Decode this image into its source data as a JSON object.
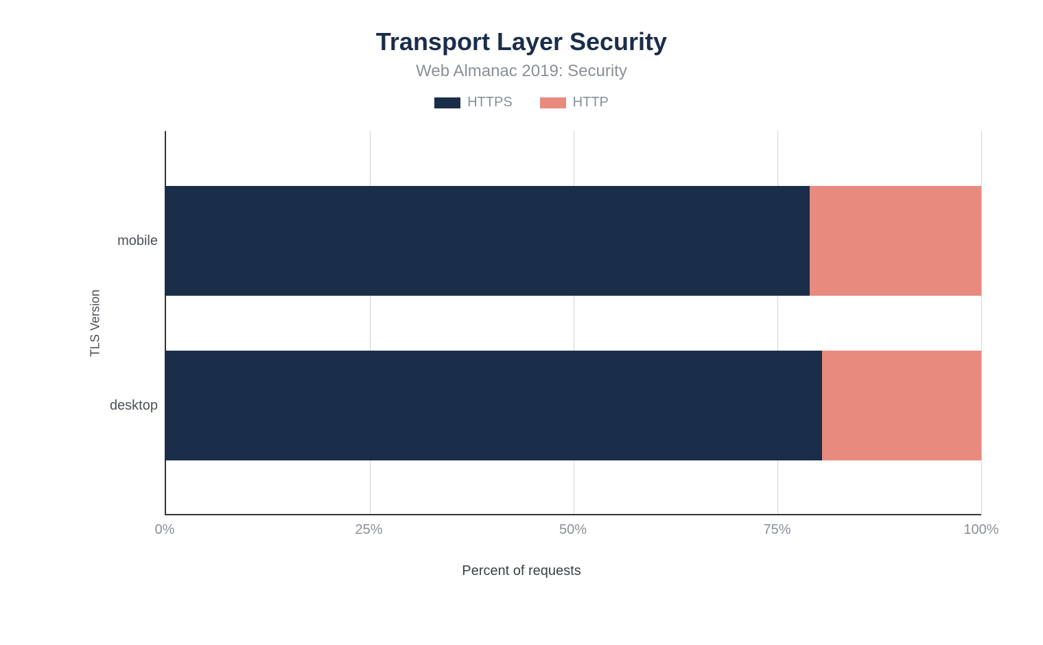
{
  "chart_data": {
    "type": "bar",
    "orientation": "horizontal",
    "stacked": true,
    "title": "Transport Layer Security",
    "subtitle": "Web Almanac 2019: Security",
    "xlabel": "Percent of requests",
    "ylabel": "TLS Version",
    "xlim": [
      0,
      100
    ],
    "x_ticks": [
      0,
      25,
      50,
      75,
      100
    ],
    "x_tick_labels": [
      "0%",
      "25%",
      "50%",
      "75%",
      "100%"
    ],
    "categories": [
      "mobile",
      "desktop"
    ],
    "series": [
      {
        "name": "HTTPS",
        "color": "#1a2e4a",
        "values": [
          79,
          80.5
        ]
      },
      {
        "name": "HTTP",
        "color": "#e98a7f",
        "values": [
          21,
          19.5
        ]
      }
    ]
  }
}
